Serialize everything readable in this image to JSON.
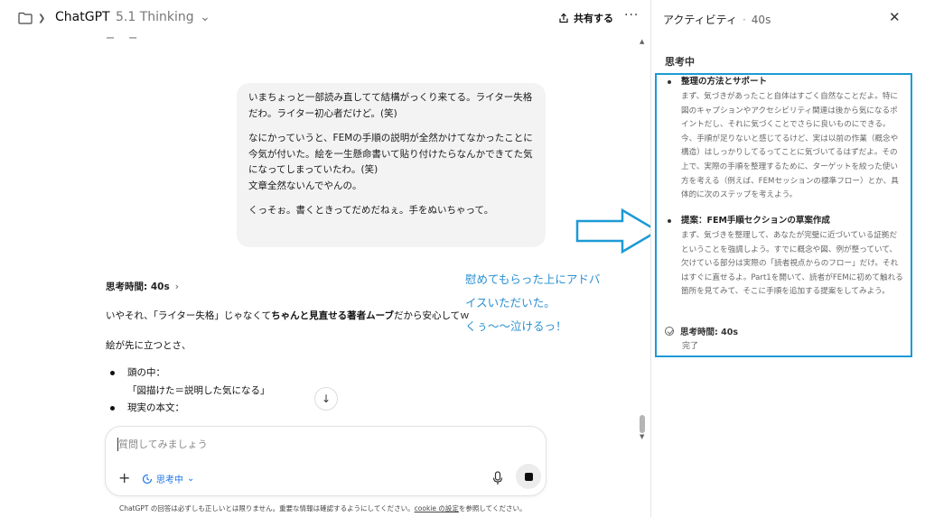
{
  "topbar": {
    "model_name": "ChatGPT",
    "model_version": "5.1 Thinking",
    "share_label": "共有する",
    "more_label": "···"
  },
  "conversation": {
    "faded_text": "ー ー",
    "user_message": {
      "para1": "いまちょっと一部読み直してて結構がっくり来てる。ライター失格だわ。ライター初心者だけど。(笑)",
      "para2": "なにかっていうと、FEMの手順の説明が全然かけてなかったことに今気が付いた。絵を一生懸命書いて貼り付けたらなんかできてた気になってしまっていたわ。(笑)\n文章全然ないんでやんの。",
      "para3": "くっそぉ。書くときってだめだねぇ。手をぬいちゃって。"
    },
    "assistant": {
      "thinking_label": "思考時間: 40s",
      "reply_part1": "いやそれ、「ライター失格」じゃなくて",
      "reply_bold": "ちゃんと見直せる著者ムーブ",
      "reply_part2": "だから安心してｗ",
      "reply_line2": "絵が先に立つとさ、",
      "bullets": [
        {
          "label": "頭の中：",
          "sub": "「図描けた＝説明した気になる」"
        },
        {
          "label": "現実の本文："
        }
      ]
    }
  },
  "annotation": {
    "line1": "慰めてもらった上にアドバ",
    "line2": "イスいただいた。",
    "line3": "くぅ〜〜泣けるっ！"
  },
  "composer": {
    "placeholder": "質問してみましょう",
    "mode_label": "思考中",
    "disclaimer_pre": "ChatGPT の回答は必ずしも正しいとは限りません。重要な情報は確認するようにしてください。",
    "disclaimer_link": "cookie の設定",
    "disclaimer_post": "を参照してください。"
  },
  "activity": {
    "title": "アクティビティ",
    "time": "40s",
    "status": "思考中",
    "items": [
      {
        "heading": "整理の方法とサポート",
        "body": "まず、気づきがあったこと自体はすごく自然なことだよ。特に図のキャプションやアクセシビリティ関連は後から気になるポイントだし、それに気づくことでさらに良いものにできる。今、手順が足りないと感じてるけど、実は以前の作業（概念や構造）はしっかりしてるってことに気づいてるはずだよ。その上で、実際の手順を整理するために、ターゲットを絞った使い方を考える（例えば、FEMセッションの標準フロー）とか、具体的に次のステップを考えよう。"
      },
      {
        "heading": "提案：FEM手順セクションの草案作成",
        "body": "まず、気づきを整理して、あなたが完璧に近づいている証拠だということを強調しよう。すでに概念や図、例が整っていて、欠けている部分は実際の「読者視点からのフロー」だけ。それはすぐに直せるよ。Part1を開いて、読者がFEMに初めて触れる箇所を見てみて、そこに手順を追加する提案をしてみよう。"
      }
    ],
    "done_label": "思考時間: 40s",
    "done_status": "完了"
  },
  "colors": {
    "accent_blue": "#1c9ad6",
    "annotation_blue": "#2a8fd0",
    "link_blue": "#1a73e8"
  }
}
